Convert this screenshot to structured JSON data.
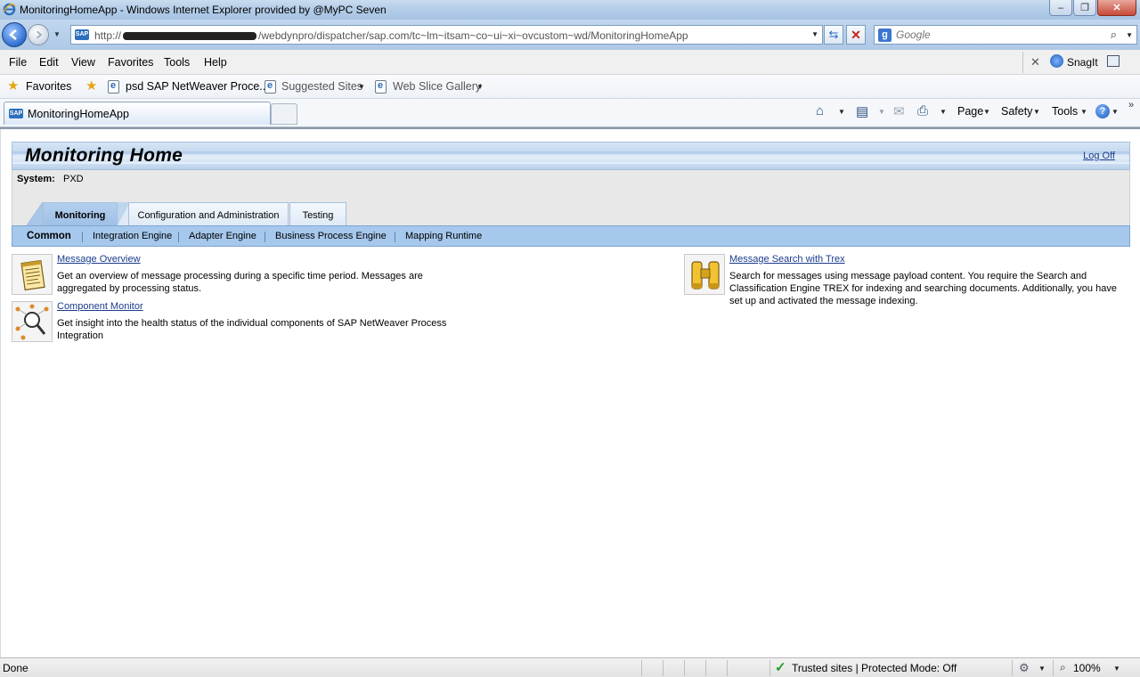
{
  "window": {
    "title": "MonitoringHomeApp - Windows Internet Explorer provided by @MyPC Seven",
    "minimize": "–",
    "restore": "❐",
    "close": "✕"
  },
  "address": {
    "url_prefix": "http://",
    "url_path": "/webdynpro/dispatcher/sap.com/tc~lm~itsam~co~ui~xi~ovcustom~wd/MonitoringHomeApp",
    "favicon": "SAP"
  },
  "search": {
    "placeholder": "Google",
    "engine_icon": "g"
  },
  "menu": {
    "file": "File",
    "edit": "Edit",
    "view": "View",
    "favorites": "Favorites",
    "tools": "Tools",
    "help": "Help",
    "snagit": "SnagIt"
  },
  "favbar": {
    "favorites": "Favorites",
    "link1": "psd SAP NetWeaver Proce...",
    "suggested": "Suggested Sites",
    "webslice": "Web Slice Gallery"
  },
  "browser_tab": {
    "label": "MonitoringHomeApp",
    "favicon": "SAP"
  },
  "commandbar": {
    "page": "Page",
    "safety": "Safety",
    "tools": "Tools",
    "help_icon": "?",
    "chevron": "»"
  },
  "app": {
    "title": "Monitoring Home",
    "logoff": "Log Off",
    "system_label": "System:",
    "system_value": "PXD",
    "tabs": [
      "Monitoring",
      "Configuration and Administration",
      "Testing"
    ],
    "subnav": [
      "Common",
      "Integration Engine",
      "Adapter Engine",
      "Business Process Engine",
      "Mapping Runtime"
    ],
    "items": [
      {
        "link": "Message Overview",
        "desc": "Get an overview of message processing during a specific time period. Messages are aggregated by processing status.",
        "icon": "notepad-icon"
      },
      {
        "link": "Component Monitor",
        "desc": "Get insight into the health status of the individual components of SAP NetWeaver Process Integration",
        "icon": "component-magnifier-icon"
      },
      {
        "link": "Message Search with Trex",
        "desc": "Search for messages using message payload content.  You require the Search and Classification Engine TREX for indexing and searching documents. Additionally, you have set up and activated the message indexing.",
        "icon": "binoculars-icon"
      }
    ]
  },
  "status": {
    "text": "Done",
    "zone": "Trusted sites | Protected Mode: Off",
    "zoom": "100%"
  },
  "colors": {
    "header_blue": "#c5d9f0",
    "subnav_blue": "#a6c8ec",
    "link": "#1a3c8c"
  }
}
